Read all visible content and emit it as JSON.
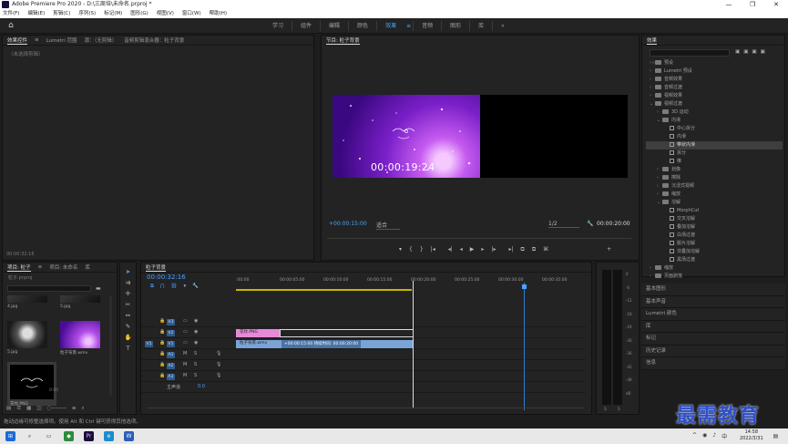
{
  "window": {
    "title": "Adobe Premiere Pro 2020 - D:\\三周培\\未命名.prproj *",
    "minimize": "—",
    "maximize": "❐",
    "close": "✕"
  },
  "menu": [
    "文件(F)",
    "编辑(E)",
    "剪辑(C)",
    "序列(S)",
    "标记(M)",
    "图形(G)",
    "视图(V)",
    "窗口(W)",
    "帮助(H)"
  ],
  "workspaces": [
    {
      "label": "学习",
      "active": false
    },
    {
      "label": "组件",
      "active": false
    },
    {
      "label": "编辑",
      "active": false
    },
    {
      "label": "颜色",
      "active": false
    },
    {
      "label": "效果",
      "active": true
    },
    {
      "label": "音频",
      "active": false
    },
    {
      "label": "图形",
      "active": false
    },
    {
      "label": "库",
      "active": false
    }
  ],
  "workspace_more": "»",
  "effect_controls": {
    "tabs": [
      "效果控件",
      "Lumetri 范围",
      "源：（无剪辑）",
      "音频剪辑混合器：粒子背景"
    ],
    "empty_text": "（未选择剪辑）",
    "timecode": "00:00:32:16"
  },
  "program": {
    "tab": "节目: 粒子背景",
    "overlay_timecode": "00:00:19:24",
    "current_timecode": "+00:00:15:00",
    "fit": "适合",
    "quality": "1/2",
    "duration": "00:00:20:00",
    "controls": [
      "▾",
      "{",
      "}",
      "|◂",
      "◂|",
      "◂",
      "▶",
      "▸",
      "|▸",
      "▸|",
      "⧉",
      "⧉",
      "⌘",
      "+"
    ]
  },
  "effects_panel": {
    "title": "效果",
    "tree": [
      {
        "indent": 0,
        "chev": "›",
        "type": "folder",
        "label": "预设",
        "sel": false
      },
      {
        "indent": 0,
        "chev": "›",
        "type": "folder",
        "label": "Lumetri 预设",
        "sel": false
      },
      {
        "indent": 0,
        "chev": "›",
        "type": "folder",
        "label": "音频效果",
        "sel": false
      },
      {
        "indent": 0,
        "chev": "›",
        "type": "folder",
        "label": "音频过渡",
        "sel": false
      },
      {
        "indent": 0,
        "chev": "›",
        "type": "folder",
        "label": "视频效果",
        "sel": false
      },
      {
        "indent": 0,
        "chev": "⌄",
        "type": "folder",
        "label": "视频过渡",
        "sel": false
      },
      {
        "indent": 1,
        "chev": "›",
        "type": "folder",
        "label": "3D 运动",
        "sel": false
      },
      {
        "indent": 1,
        "chev": "⌄",
        "type": "folder",
        "label": "内滑",
        "sel": false
      },
      {
        "indent": 2,
        "chev": "",
        "type": "fx",
        "label": "中心拆分",
        "sel": false
      },
      {
        "indent": 2,
        "chev": "",
        "type": "fx",
        "label": "内滑",
        "sel": false
      },
      {
        "indent": 2,
        "chev": "",
        "type": "fx",
        "label": "带状内滑",
        "sel": true
      },
      {
        "indent": 2,
        "chev": "",
        "type": "fx",
        "label": "拆分",
        "sel": false
      },
      {
        "indent": 2,
        "chev": "",
        "type": "fx",
        "label": "推",
        "sel": false
      },
      {
        "indent": 1,
        "chev": "›",
        "type": "folder",
        "label": "划像",
        "sel": false
      },
      {
        "indent": 1,
        "chev": "›",
        "type": "folder",
        "label": "擦除",
        "sel": false
      },
      {
        "indent": 1,
        "chev": "›",
        "type": "folder",
        "label": "沉浸式视频",
        "sel": false
      },
      {
        "indent": 1,
        "chev": "›",
        "type": "folder",
        "label": "缩放",
        "sel": false
      },
      {
        "indent": 1,
        "chev": "⌄",
        "type": "folder",
        "label": "溶解",
        "sel": false
      },
      {
        "indent": 2,
        "chev": "",
        "type": "fx",
        "label": "MorphCut",
        "sel": false
      },
      {
        "indent": 2,
        "chev": "",
        "type": "fx",
        "label": "交叉溶解",
        "sel": false
      },
      {
        "indent": 2,
        "chev": "",
        "type": "fx",
        "label": "叠加溶解",
        "sel": false
      },
      {
        "indent": 2,
        "chev": "",
        "type": "fx",
        "label": "白场过渡",
        "sel": false
      },
      {
        "indent": 2,
        "chev": "",
        "type": "fx",
        "label": "胶片溶解",
        "sel": false
      },
      {
        "indent": 2,
        "chev": "",
        "type": "fx",
        "label": "非叠加溶解",
        "sel": false
      },
      {
        "indent": 2,
        "chev": "",
        "type": "fx",
        "label": "黑场过渡",
        "sel": false
      },
      {
        "indent": 0,
        "chev": "›",
        "type": "folder",
        "label": "缩放",
        "sel": false
      },
      {
        "indent": 0,
        "chev": "›",
        "type": "folder",
        "label": "页面剥落",
        "sel": false
      }
    ],
    "side_panels": [
      "基本图形",
      "基本声音",
      "Lumetri 颜色",
      "库",
      "标记",
      "历史记录",
      "信息"
    ]
  },
  "project": {
    "tabs": [
      "项目: 粒子",
      "项目: 未命名",
      "库"
    ],
    "file": "粒子.prproj",
    "items": [
      {
        "label": "4.jpg",
        "type": "dark"
      },
      {
        "label": "5.jpg",
        "type": "dark"
      },
      {
        "label": "5.jpg",
        "type": "cat"
      },
      {
        "label": "粒子背景.wmv",
        "type": "purple"
      },
      {
        "label": "花纹.PNG",
        "type": "ornament"
      },
      {
        "label": "0:00",
        "type": "time"
      }
    ]
  },
  "timeline": {
    "tab": "粒子背景",
    "timecode": "00:00:32:16",
    "ruler": [
      ":00:00",
      "00:00:05:00",
      "00:00:10:00",
      "00:00:15:00",
      "00:00:20:00",
      "00:00:25:00",
      "00:00:30:00",
      "00:00:35:00"
    ],
    "video_tracks": [
      "V3",
      "V2",
      "V1"
    ],
    "audio_tracks": [
      "A1",
      "A2",
      "A3"
    ],
    "master": "主声道",
    "master_value": "0.0",
    "clips": {
      "v2_label": "花纹.PNG",
      "v1_label": "粒子背景.wmv",
      "tooltip": "+00:00:15:00 持续时间: 00:00:20:00"
    },
    "meter_scale": [
      "0",
      "-6",
      "-12",
      "-18",
      "-24",
      "-30",
      "-36",
      "-42",
      "-48",
      "dB"
    ],
    "meter_s": [
      "S",
      "S"
    ]
  },
  "status_bar": "拖动边缘可修整选择项。使用 Alt 和 Ctrl 键可获得其他选项。",
  "taskbar": {
    "time": "14:58",
    "date": "2022/3/31"
  },
  "watermark": "最需教育"
}
